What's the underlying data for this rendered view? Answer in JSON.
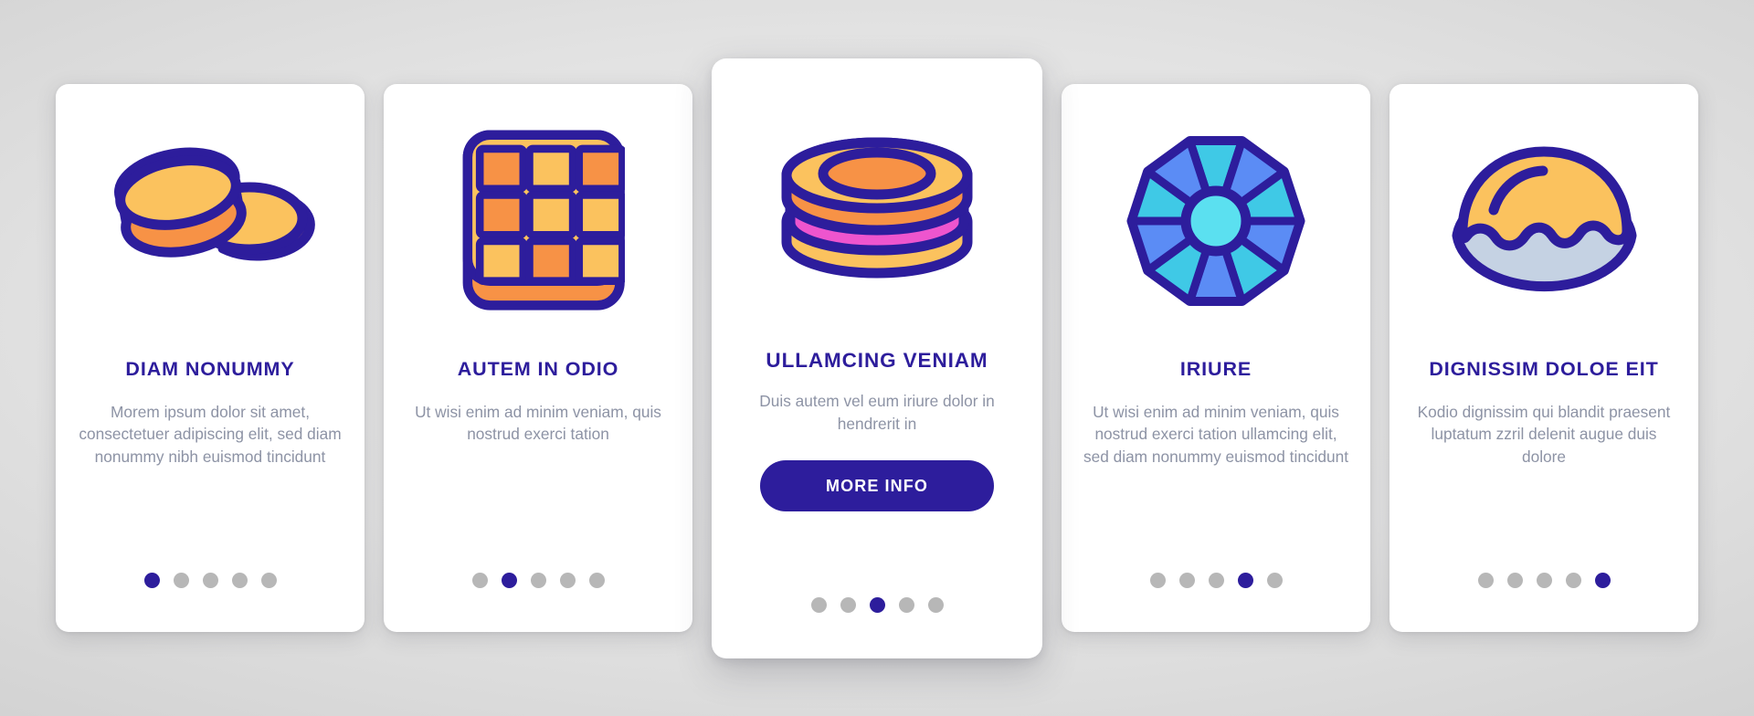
{
  "theme": {
    "accent": "#2D1D9C",
    "title_color": "#2D1D9C",
    "body_color": "#8D93A5",
    "card_bg": "#FFFFFF",
    "dot_inactive": "#B7B7B7",
    "dot_active": "#2D1D9C",
    "background": "#D6D6D6",
    "icon_outline": "#2D1D9C",
    "icon_yellow": "#FBC25E",
    "icon_orange": "#F79246",
    "icon_pink": "#EE55CE",
    "icon_blue": "#5B8CF5",
    "icon_cyan": "#3FC9E6",
    "icon_light_cyan": "#5BE0F0",
    "icon_grey_blue": "#C5D2E3"
  },
  "total_dots": 5,
  "cards": [
    {
      "icon": "stacked-cookies-icon",
      "title": "DIAM NONUMMY",
      "body": "Morem ipsum dolor sit amet, consectetuer adipiscing elit, sed diam nonummy nibh euismod tincidunt",
      "active_dot": 1,
      "featured": false,
      "cta_label": null
    },
    {
      "icon": "chocolate-bar-icon",
      "title": "AUTEM IN ODIO",
      "body": "Ut wisi enim ad minim veniam, quis nostrud exerci tation",
      "active_dot": 2,
      "featured": false,
      "cta_label": null
    },
    {
      "icon": "macaron-icon",
      "title": "ULLAMCING VENIAM",
      "body": "Duis autem vel eum iriure dolor in hendrerit in",
      "active_dot": 3,
      "featured": true,
      "cta_label": "MORE INFO"
    },
    {
      "icon": "gem-rosette-icon",
      "title": "IRIURE",
      "body": "Ut wisi enim ad minim veniam, quis nostrud exerci tation ullamcing elit, sed diam nonummy euismod tincidunt",
      "active_dot": 4,
      "featured": false,
      "cta_label": null
    },
    {
      "icon": "cream-bun-icon",
      "title": "DIGNISSIM DOLOE EIT",
      "body": "Kodio dignissim qui blandit praesent luptatum zzril delenit augue duis dolore",
      "active_dot": 5,
      "featured": false,
      "cta_label": null
    }
  ]
}
